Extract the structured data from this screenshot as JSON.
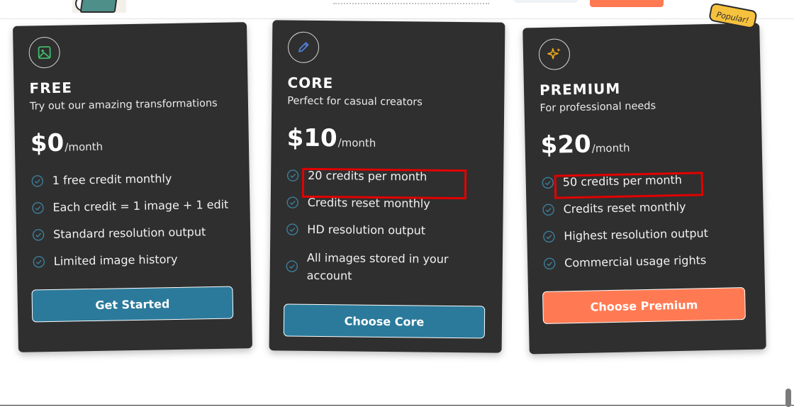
{
  "plans": [
    {
      "name": "FREE",
      "description": "Try out our amazing transformations",
      "price": "$0",
      "period": "/month",
      "features": [
        "1 free credit monthly",
        "Each credit = 1 image + 1 edit",
        "Standard resolution output",
        "Limited image history"
      ],
      "button": "Get Started",
      "icon": "image-icon"
    },
    {
      "name": "CORE",
      "description": "Perfect for casual creators",
      "price": "$10",
      "period": "/month",
      "features": [
        "20 credits per month",
        "Credits reset monthly",
        "HD resolution output",
        "All images stored in your account"
      ],
      "button": "Choose Core",
      "icon": "pencil-icon"
    },
    {
      "name": "PREMIUM",
      "description": "For professional needs",
      "price": "$20",
      "period": "/month",
      "features": [
        "50 credits per month",
        "Credits reset monthly",
        "Highest resolution output",
        "Commercial usage rights"
      ],
      "button": "Choose Premium",
      "icon": "sparkles-icon",
      "badge": "Popular!"
    }
  ],
  "colors": {
    "card_bg": "#2f2f2f",
    "teal": "#2b7a9b",
    "orange": "#ff7a53",
    "check": "#3d7f9b",
    "highlight": "#e30000",
    "badge": "#f6c23e"
  }
}
